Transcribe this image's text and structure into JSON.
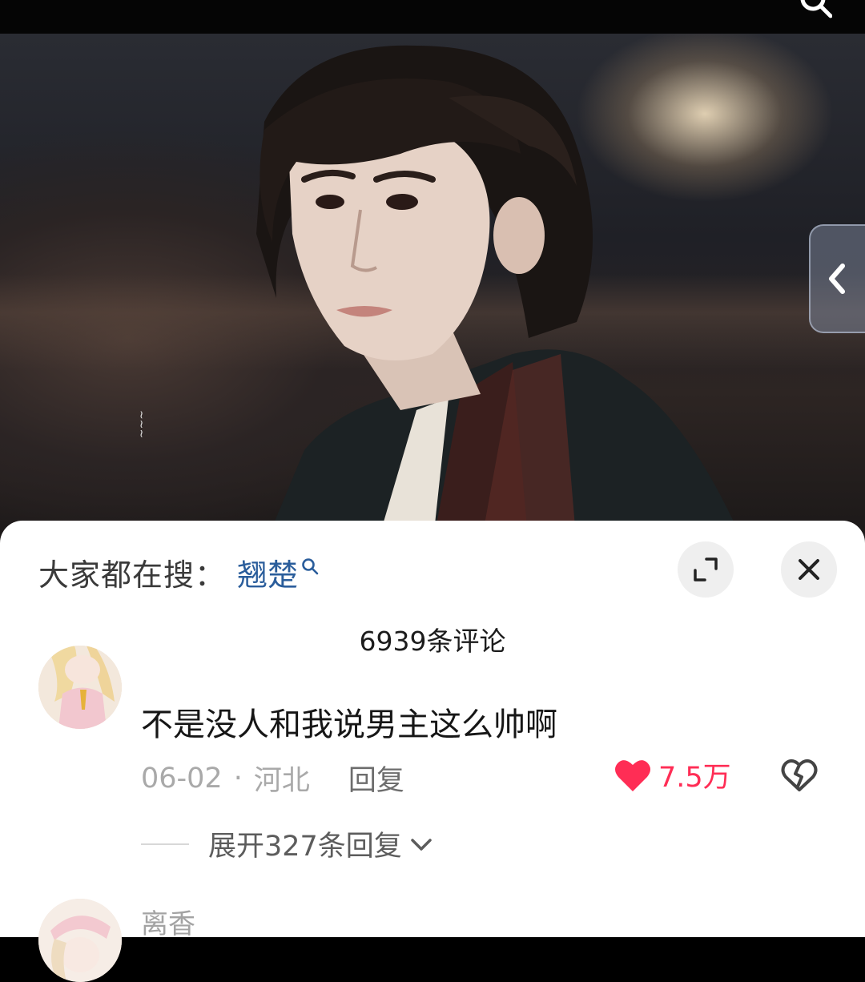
{
  "search_bar": {
    "prefix": "大家都在搜：",
    "term": "翘楚"
  },
  "comments_header": {
    "count_label": "6939条评论"
  },
  "comments": [
    {
      "text": "不是没人和我说男主这么帅啊",
      "date": "06-02",
      "separator": "·",
      "location": "河北",
      "reply_label": "回复",
      "likes": "7.5万",
      "expand_replies_label": "展开327条回复"
    },
    {
      "username": "离香"
    }
  ],
  "colors": {
    "like_red": "#ff2d55",
    "search_term_blue": "#2a5d9b",
    "sheet_bg": "#ffffff"
  },
  "icons": [
    "search-icon",
    "chevron-left-icon",
    "expand-icon",
    "close-icon",
    "heart-icon",
    "broken-heart-icon",
    "chevron-down-icon",
    "search-mini-icon"
  ]
}
